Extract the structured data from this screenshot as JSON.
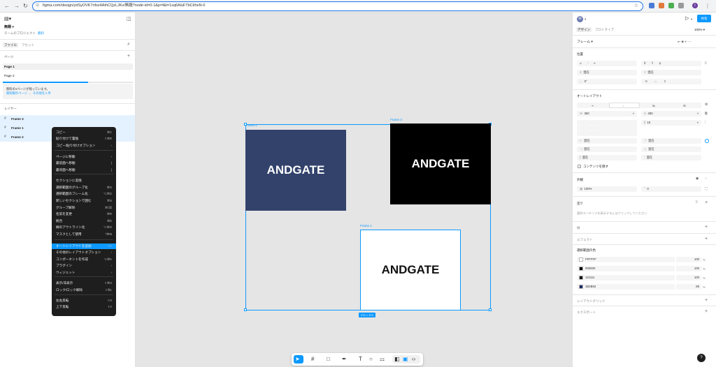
{
  "browser": {
    "url": "figma.com/design/ydSyOVK7nfsz4AthCQzLJKv/無題?node-id=0-1&p=f&t=1sq6AluFTbCIiheN-0",
    "profile": "I"
  },
  "left_panel": {
    "file_name": "無題",
    "project": "チームのプロジェクト",
    "plan": "無料",
    "tabs": [
      "ファイル",
      "アセット"
    ],
    "pages_title": "ページ",
    "pages": [
      "Page 1",
      "Page 2"
    ],
    "notice_line1": "無料の1ページが残っています。",
    "notice_link1": "無制限のページ",
    "notice_link2": "その他を入手",
    "layers_title": "レイヤー",
    "layers": [
      "Frame 3",
      "Frame 1",
      "Frame 2"
    ]
  },
  "context_menu": [
    {
      "label": "コピー",
      "shortcut": "⌘C"
    },
    {
      "label": "貼り付けて置換",
      "shortcut": "⇧⌘R"
    },
    {
      "label": "コピー/貼り付けオプション",
      "shortcut": "›"
    },
    {
      "label": "ページに移動",
      "shortcut": "›"
    },
    {
      "label": "最前面へ移動",
      "shortcut": "]"
    },
    {
      "label": "最背面へ移動",
      "shortcut": "["
    },
    {
      "label": "セクションに変換",
      "shortcut": ""
    },
    {
      "label": "選択範囲のグループ化",
      "shortcut": "⌘G"
    },
    {
      "label": "選択範囲のフレーム化",
      "shortcut": "⌥⌘G"
    },
    {
      "label": "新しいセクションで囲む",
      "shortcut": "⌘S"
    },
    {
      "label": "グループ解除",
      "shortcut": "⌘⌫"
    },
    {
      "label": "名前を変更",
      "shortcut": "⌘R"
    },
    {
      "label": "統合",
      "shortcut": "⌘E"
    },
    {
      "label": "線のアウトライン化",
      "shortcut": "⌥⌘O"
    },
    {
      "label": "マスクとして使用",
      "shortcut": "^⌘M"
    },
    {
      "label": "オートレイアウトを追加",
      "shortcut": "⇧A"
    },
    {
      "label": "その他のレイアウトオプション",
      "shortcut": "›"
    },
    {
      "label": "コンポーネントを作成",
      "shortcut": "⌥⌘K"
    },
    {
      "label": "プラグイン",
      "shortcut": "›"
    },
    {
      "label": "ウィジェット",
      "shortcut": "›"
    },
    {
      "label": "表示/非表示",
      "shortcut": "⇧⌘H"
    },
    {
      "label": "ロック/ロック解除",
      "shortcut": "⇧⌘L"
    },
    {
      "label": "左右反転",
      "shortcut": "⇧H"
    },
    {
      "label": "上下反転",
      "shortcut": "⇧V"
    }
  ],
  "canvas": {
    "outer_label": "Frame 2",
    "frame3_label": "Frame 3",
    "frame1_label": "Frame 1",
    "frame_text": "ANDGATE",
    "size_badge": "370 × 374",
    "colors": {
      "navy": "#2B3B6B",
      "black": "#000000",
      "white": "#FFFFFF",
      "selection": "#0D99FF"
    }
  },
  "right_panel": {
    "avatar": "M",
    "share": "共有",
    "tabs": [
      "デザイン",
      "プロトタイプ"
    ],
    "zoom": "100%",
    "frame_title": "フレーム",
    "position_title": "位置",
    "x_label": "X",
    "x_value": "混在",
    "y_label": "Y",
    "y_value": "混在",
    "rotation_value": "0°",
    "autolayout_title": "オートレイアウト",
    "w_label": "W",
    "w_value": "360",
    "h_label": "H",
    "h_value": "280",
    "gap_value": "10",
    "pad_values": [
      "混在",
      "混在",
      "混在",
      "混在",
      "混在",
      "混在"
    ],
    "clip_label": "コンテンツを隠す",
    "appearance_title": "外観",
    "opacity": "100%",
    "radius": "0",
    "fill_title": "塗り",
    "fill_hint": "選択コンテンツを表示するにはクリックしてください",
    "stroke_title": "線",
    "effects_title": "エフェクト",
    "selection_colors_title": "選択範囲の色",
    "selection_colors": [
      {
        "hex": "FFFFFF",
        "color": "#FFFFFF",
        "opacity": "100",
        "unit": "%"
      },
      {
        "hex": "000000",
        "color": "#000000",
        "opacity": "100",
        "unit": "%"
      },
      {
        "hex": "121111",
        "color": "#121111",
        "opacity": "100",
        "unit": "%"
      },
      {
        "hex": "1B2B62",
        "color": "#1B2B62",
        "opacity": "85",
        "unit": "%"
      }
    ],
    "layout_grid_title": "レイアウトグリッド",
    "export_title": "エクスポート",
    "help": "?"
  }
}
